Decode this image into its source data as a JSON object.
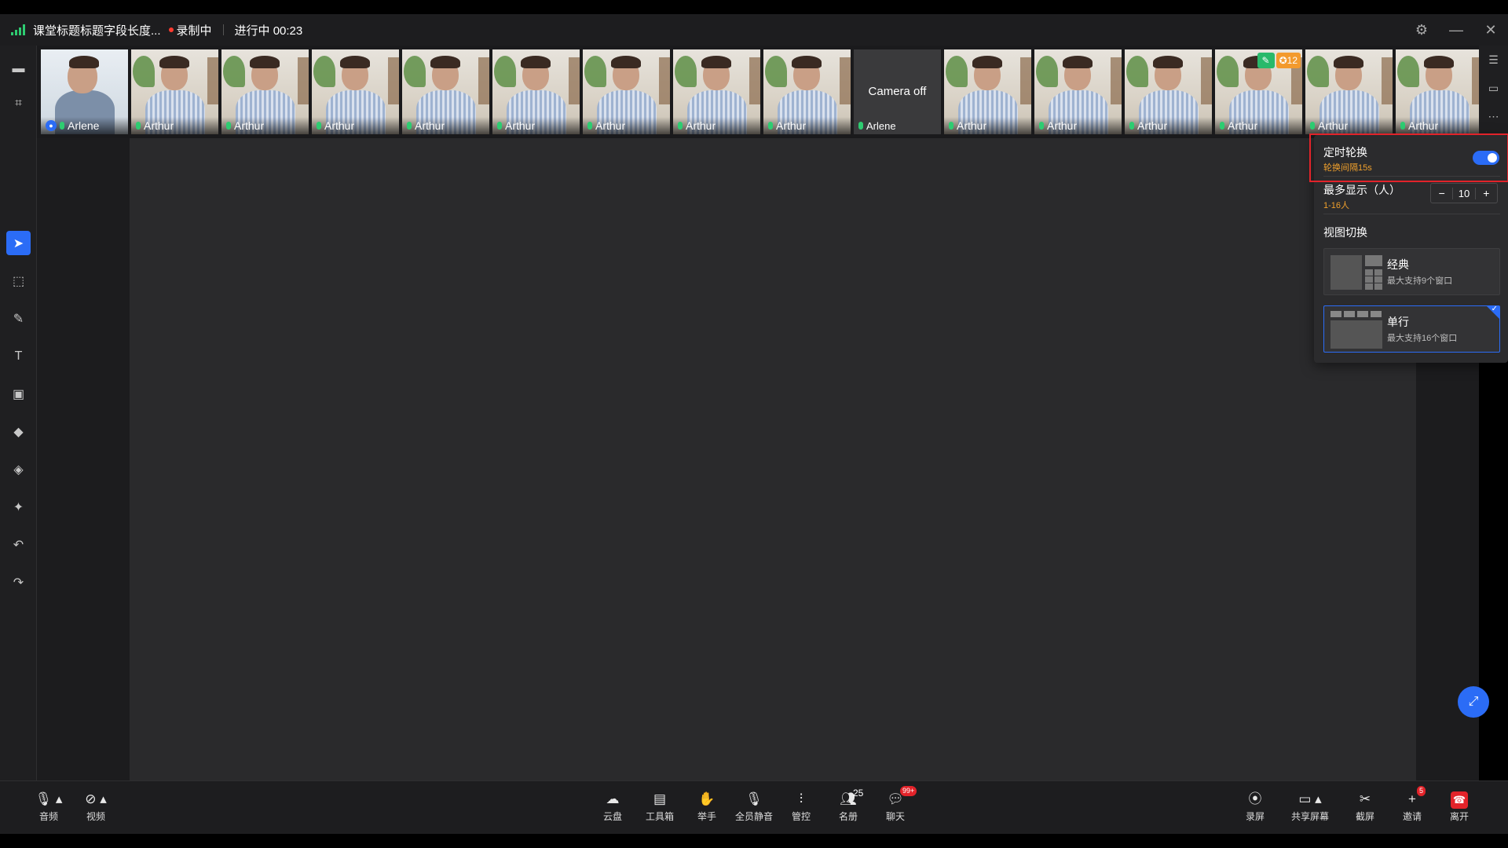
{
  "titlebar": {
    "title": "课堂标题标题字段长度...",
    "recording": "录制中",
    "status": "进行中 00:23"
  },
  "strip": {
    "tiles": [
      {
        "name": "Arlene"
      },
      {
        "name": "Arthur"
      },
      {
        "name": "Arthur"
      },
      {
        "name": "Arthur"
      },
      {
        "name": "Arthur"
      },
      {
        "name": "Arthur"
      },
      {
        "name": "Arthur"
      },
      {
        "name": "Arthur"
      },
      {
        "name": "Arthur"
      },
      {
        "name": "Arlene",
        "camera_text": "Camera off"
      },
      {
        "name": "Arthur"
      },
      {
        "name": "Arthur"
      },
      {
        "name": "Arthur"
      },
      {
        "name": "Arthur",
        "badge_count": "12"
      },
      {
        "name": "Arthur"
      },
      {
        "name": "Arthur"
      }
    ]
  },
  "popup": {
    "rotation_label": "定时轮换",
    "rotation_interval": "轮换间隔15s",
    "max_display_label": "最多显示（人）",
    "max_display_range": "1-16人",
    "max_display_value": "10",
    "minus": "−",
    "plus": "+",
    "view_switch_label": "视图切换",
    "views": [
      {
        "name": "经典",
        "desc": "最大支持9个窗口"
      },
      {
        "name": "单行",
        "desc": "最大支持16个窗口"
      }
    ]
  },
  "bottombar": {
    "audio": "音频",
    "video": "视频",
    "cloud": "云盘",
    "toolbox": "工具箱",
    "raise_hand": "举手",
    "mute_all": "全员静音",
    "control": "管控",
    "roster": "名册",
    "roster_count": "25",
    "chat": "聊天",
    "chat_badge": "99+",
    "record": "录屏",
    "share_screen": "共享屏幕",
    "screenshot": "截屏",
    "invite": "邀请",
    "invite_badge": "5",
    "leave": "离开"
  },
  "colors": {
    "accent": "#2b6cf6",
    "danger": "#e2232a",
    "warning": "#f0a02c",
    "signal": "#2ecc71"
  }
}
